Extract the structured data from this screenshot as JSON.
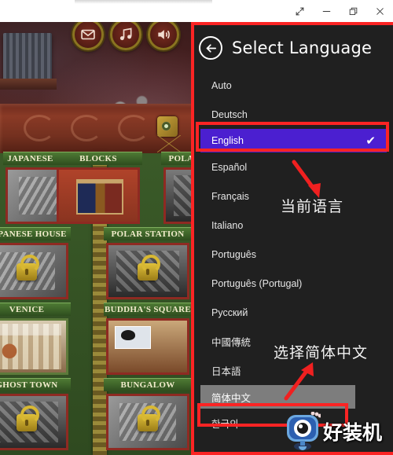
{
  "window": {
    "controls": [
      {
        "name": "fullscreen",
        "icon": "expand-arrows-icon",
        "label": "Full screen"
      },
      {
        "name": "minimize",
        "icon": "minimize-icon",
        "label": "Minimize"
      },
      {
        "name": "restore",
        "icon": "restore-icon",
        "label": "Restore"
      },
      {
        "name": "close",
        "icon": "close-icon",
        "label": "Close"
      }
    ]
  },
  "game": {
    "toolbar_buttons": [
      {
        "name": "mail",
        "icon": "envelope-icon"
      },
      {
        "name": "music",
        "icon": "music-note-icon"
      },
      {
        "name": "sound",
        "icon": "speaker-icon"
      }
    ],
    "levels": [
      {
        "title": "BLOCKS",
        "locked": false,
        "art": "art-blocks"
      },
      {
        "title": "JAPANESE HOUSE",
        "locked": true,
        "art": "art-gray"
      },
      {
        "title": "POLAR STATION",
        "locked": true,
        "art": "art-dark"
      },
      {
        "title": "VENICE",
        "locked": false,
        "art": "art-venice"
      },
      {
        "title": "BUDDHA'S SQUARE",
        "locked": false,
        "art": "art-buddha"
      },
      {
        "title": "GHOST TOWN",
        "locked": true,
        "art": "art-dark"
      },
      {
        "title": "BUNGALOW",
        "locked": true,
        "art": "art-gray"
      }
    ]
  },
  "panel": {
    "title": "Select Language",
    "back_icon": "back-arrow-icon",
    "check_glyph": "✔",
    "accent_selected": "#4b1fd0",
    "accent_annotation": "#fb2424",
    "languages": [
      {
        "label": "Auto",
        "state": "normal"
      },
      {
        "label": "Deutsch",
        "state": "normal"
      },
      {
        "label": "English",
        "state": "selected"
      },
      {
        "label": "Español",
        "state": "normal"
      },
      {
        "label": "Français",
        "state": "normal"
      },
      {
        "label": "Italiano",
        "state": "normal"
      },
      {
        "label": "Português",
        "state": "normal"
      },
      {
        "label": "Português (Portugal)",
        "state": "normal"
      },
      {
        "label": "Русский",
        "state": "normal"
      },
      {
        "label": "中國傳統",
        "state": "normal"
      },
      {
        "label": "日本語",
        "state": "normal"
      },
      {
        "label": "简体中文",
        "state": "hover"
      },
      {
        "label": "한국의",
        "state": "normal"
      }
    ]
  },
  "annotations": {
    "current_language": "当前语言",
    "select_simplified": "选择简体中文",
    "arrow_current_icon": "red-arrow-down-right-icon",
    "arrow_select_icon": "red-arrow-up-right-icon",
    "box_english_name": "highlight-box-english",
    "box_chinese_name": "highlight-box-simplified-chinese"
  },
  "watermark": {
    "text": "好装机",
    "logo_icon": "monitor-mascot-icon"
  }
}
